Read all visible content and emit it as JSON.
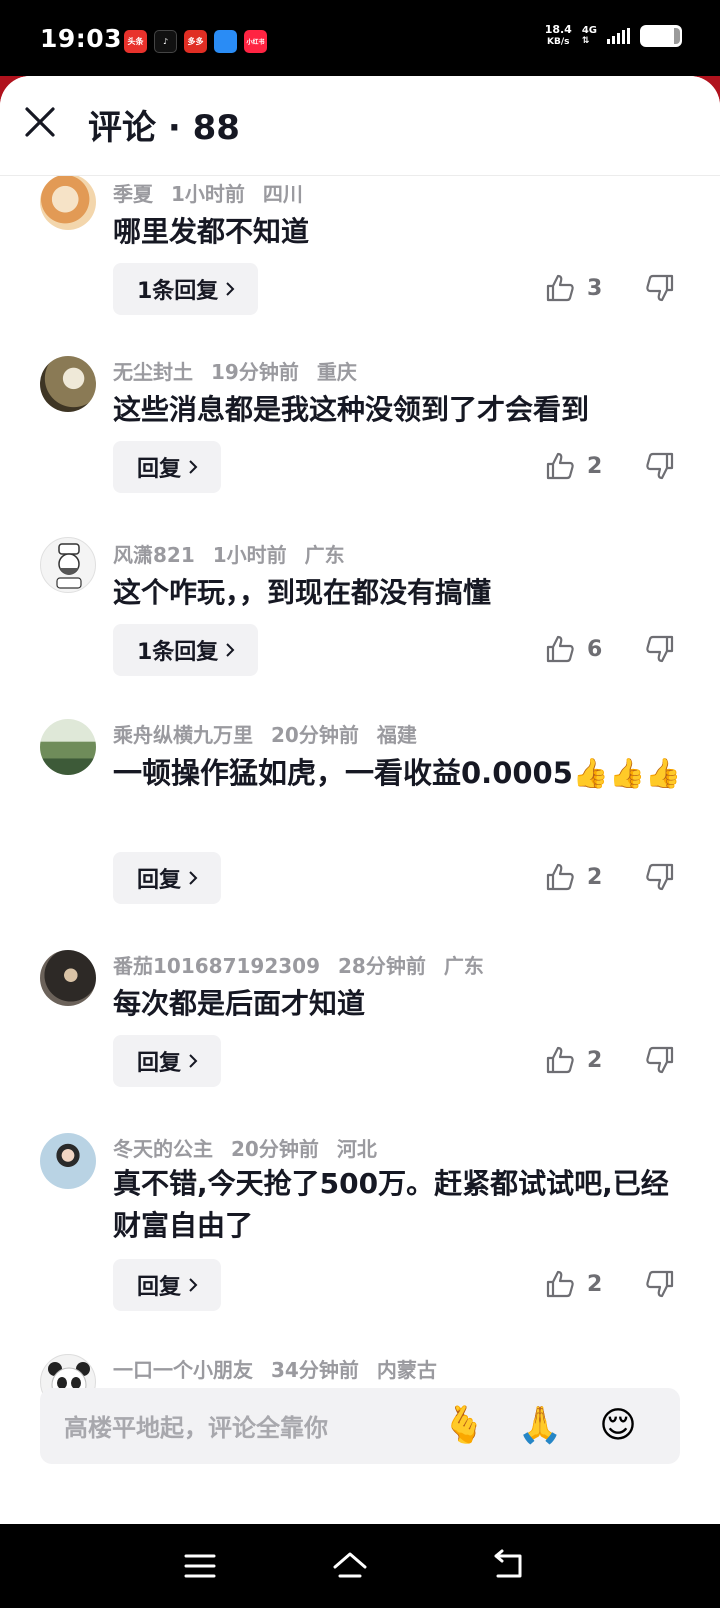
{
  "status_bar": {
    "time": "19:03",
    "speed_value": "18.4",
    "speed_unit": "KB/s",
    "network": "4G",
    "apps": [
      {
        "label": "头条",
        "color": "#e8322c"
      },
      {
        "label": "♪",
        "color": "#111111"
      },
      {
        "label": "多多",
        "color": "#e02e24"
      },
      {
        "label": "",
        "color": "#2a8cf5"
      },
      {
        "label": "小红书",
        "color": "#ff2442"
      }
    ]
  },
  "header": {
    "title": "评论 · 88"
  },
  "comments": [
    {
      "user": "季夏",
      "time": "1小时前",
      "location": "四川",
      "text": "哪里发都不知道",
      "reply_label": "1条回复",
      "likes": "3",
      "avatar_color": "#e7b27a"
    },
    {
      "user": "无尘封土",
      "time": "19分钟前",
      "location": "重庆",
      "text": "这些消息都是我这种没领到了才会看到",
      "reply_label": "回复",
      "likes": "2",
      "avatar_color": "#a58a62"
    },
    {
      "user": "风潇821",
      "time": "1小时前",
      "location": "广东",
      "text": "这个咋玩，，到现在都没有搞懂",
      "reply_label": "1条回复",
      "likes": "6",
      "avatar_color": "#e9e9e9"
    },
    {
      "user": "乘舟纵横九万里",
      "time": "20分钟前",
      "location": "福建",
      "text": "一顿操作猛如虎，一看收益0.0005👍👍👍",
      "reply_label": "回复",
      "likes": "2",
      "avatar_color": "#6f8c5a"
    },
    {
      "user": "番茄101687192309",
      "time": "28分钟前",
      "location": "广东",
      "text": "每次都是后面才知道",
      "reply_label": "回复",
      "likes": "2",
      "avatar_color": "#3f3a36"
    },
    {
      "user": "冬天的公主",
      "time": "20分钟前",
      "location": "河北",
      "text": "真不错,今天抢了500万。赶紧都试试吧,已经财富自由了",
      "reply_label": "回复",
      "likes": "2",
      "avatar_color": "#9fc1d8"
    },
    {
      "user": "一口一个小朋友",
      "time": "34分钟前",
      "location": "内蒙古",
      "text": "",
      "reply_label": "",
      "likes": "",
      "avatar_color": "#f0f0f0"
    }
  ],
  "input": {
    "placeholder": "高楼平地起，评论全靠你",
    "emoji_1": "🫰",
    "emoji_2": "🙏",
    "emoji_3": "😌"
  },
  "icons": {
    "close": "close-icon",
    "like": "thumbs-up-icon",
    "dislike": "thumbs-down-icon",
    "menu": "menu-icon",
    "home": "home-icon",
    "back": "back-icon"
  }
}
